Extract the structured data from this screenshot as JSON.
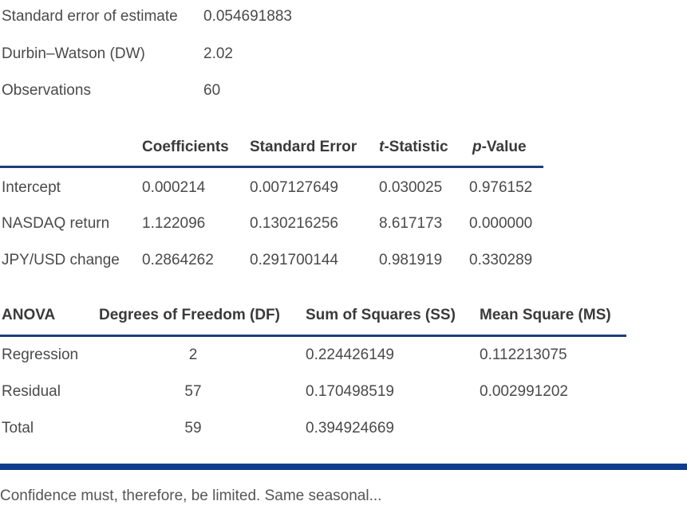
{
  "summary_stats": [
    {
      "label": "Standard error of estimate",
      "value": "0.054691883"
    },
    {
      "label": "Durbin–Watson (DW)",
      "value": "2.02"
    },
    {
      "label": "Observations",
      "value": "60"
    }
  ],
  "coef_table": {
    "headers": {
      "coefficients": "Coefficients",
      "std_error": "Standard Error",
      "t_stat_italic": "t",
      "t_stat_rest": "-Statistic",
      "p_value_italic": "p",
      "p_value_rest": "-Value"
    },
    "rows": [
      {
        "name": "Intercept",
        "coef": "0.000214",
        "se": "0.007127649",
        "t": "0.030025",
        "p": "0.976152"
      },
      {
        "name": "NASDAQ return",
        "coef": "1.122096",
        "se": "0.130216256",
        "t": "8.617173",
        "p": "0.000000"
      },
      {
        "name": "JPY/USD change",
        "coef": "0.2864262",
        "se": "0.291700144",
        "t": "0.981919",
        "p": "0.330289"
      }
    ]
  },
  "anova_table": {
    "headers": {
      "anova": "ANOVA",
      "df": "Degrees of Freedom (DF)",
      "ss": "Sum of Squares (SS)",
      "ms": "Mean Square (MS)"
    },
    "rows": [
      {
        "name": "Regression",
        "df": "2",
        "ss": "0.224426149",
        "ms": "0.112213075"
      },
      {
        "name": "Residual",
        "df": "57",
        "ss": "0.170498519",
        "ms": "0.002991202"
      },
      {
        "name": "Total",
        "df": "59",
        "ss": "0.394924669",
        "ms": ""
      }
    ]
  },
  "footer": {
    "partial_text": "Confidence must, therefore, be limited. Same seasonal... "
  },
  "colors": {
    "rule": "#1d3d7a",
    "footer_bar": "#0d3d8c"
  }
}
